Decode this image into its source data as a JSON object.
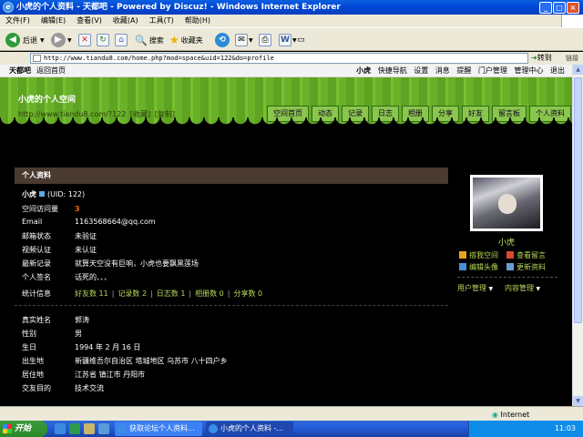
{
  "window": {
    "title": "小虎的个人资料 - 天都吧 - Powered by Discuz! - Windows Internet Explorer"
  },
  "menu": [
    "文件(F)",
    "编辑(E)",
    "查看(V)",
    "收藏(A)",
    "工具(T)",
    "帮助(H)"
  ],
  "toolbar": {
    "back": "后退",
    "search": "搜索",
    "favorites": "收藏夹"
  },
  "address": {
    "url": "http://www.tiandu8.com/home.php?mod=space&uid=122&do=profile",
    "go": "转到",
    "links": "链接"
  },
  "topnav": {
    "site": "天都吧",
    "back_home": "返回首页",
    "user": "小虎",
    "right_items": [
      "快捷导航",
      "设置",
      "消息",
      "提醒",
      "门户管理",
      "管理中心",
      "退出"
    ]
  },
  "space": {
    "title": "小虎的个人空间",
    "url": "http://www.tiandu8.com/?122",
    "fav": "[收藏]",
    "copy": "[复制]"
  },
  "tabs": [
    "空间首页",
    "动态",
    "记录",
    "日志",
    "相册",
    "分享",
    "好友",
    "留言板",
    "个人资料"
  ],
  "section_title": "个人资料",
  "profile": {
    "name": "小虎",
    "uid": "(UID: 122)",
    "visits_label": "空间访问量",
    "visits": "3",
    "email_label": "Email",
    "email": "1163568664@qq.com",
    "email_status_label": "邮箱状态",
    "email_status": "未验证",
    "video_label": "视频认证",
    "video": "未认证",
    "recent_label": "最新记录",
    "recent": "就算天空没有巨响，小虎也要飘黑莲场",
    "sign_label": "个人签名",
    "sign": "话死的、、、",
    "stats_label": "统计信息",
    "stats": [
      "好友数 11",
      "记录数 2",
      "日志数 1",
      "相册数 0",
      "分享数 0"
    ],
    "realname_label": "真实姓名",
    "realname": "郭涛",
    "gender_label": "性别",
    "gender": "男",
    "birthday_label": "生日",
    "birthday": "1994 年 2 月 16 日",
    "birthplace_label": "出生地",
    "birthplace": "新疆维吾尔自治区 塔城地区 乌苏市 八十四户乡",
    "residence_label": "居住地",
    "residence": "江苏省 镇江市 丹阳市",
    "purpose_label": "交友目的",
    "purpose": "技术交流"
  },
  "sidebar": {
    "name": "小虎",
    "actions": [
      "搭我空间",
      "查看留言",
      "编辑头像",
      "更新资料"
    ],
    "menus": [
      "用户管理",
      "内容管理"
    ]
  },
  "status": {
    "zone": "Internet"
  },
  "taskbar": {
    "start": "开始",
    "tasks": [
      "获取论坛个人资料...",
      "小虎的个人资料 -..."
    ],
    "time": "11:03"
  },
  "colors": {
    "link": "#b7d85a",
    "accent": "#f06a0a",
    "banner": "#6aaf2a"
  }
}
